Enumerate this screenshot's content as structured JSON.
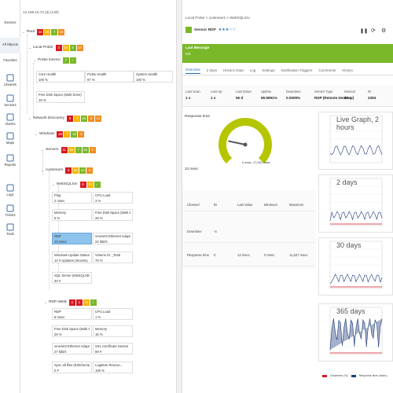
{
  "nav": [
    {
      "label": "Devices",
      "icon": "devices-icon"
    },
    {
      "label": "All Objects",
      "icon": "all-objects-icon"
    },
    {
      "label": "Favorites",
      "icon": "favorites-icon"
    },
    {
      "label": "Libraries",
      "icon": "libraries-icon"
    },
    {
      "label": "Sensors",
      "icon": "sensors-icon"
    },
    {
      "label": "Alarms",
      "icon": "alarms-icon"
    },
    {
      "label": "Maps",
      "icon": "maps-icon"
    },
    {
      "label": "Reports",
      "icon": "reports-icon"
    },
    {
      "label": "Logs",
      "icon": "logs-icon"
    },
    {
      "label": "Tickets",
      "icon": "tickets-icon"
    },
    {
      "label": "Tools",
      "icon": "tools-icon"
    }
  ],
  "tree": {
    "header": "12.168.10.72 (d) (130)",
    "nodes": [
      {
        "label": "Root",
        "badges": [
          [
            "14",
            "r"
          ],
          [
            "16",
            "y"
          ],
          [
            "7",
            "g"
          ],
          [
            "10",
            "o"
          ]
        ]
      },
      {
        "label": "Local Probe",
        "badges": [
          [
            "3",
            "r"
          ],
          [
            "16",
            "y"
          ],
          [
            "6",
            "g"
          ],
          [
            "10",
            "o"
          ]
        ]
      },
      {
        "label": "Probe Device",
        "badges": [
          [
            "7",
            "g"
          ],
          [
            "✓",
            "g"
          ]
        ]
      },
      {
        "label": "Network Discovery",
        "badges": [
          [
            "8",
            "r"
          ],
          [
            "3",
            "y"
          ],
          [
            "16",
            "g"
          ],
          [
            "6",
            "o"
          ],
          [
            "10",
            "o"
          ]
        ]
      },
      {
        "label": "Windows",
        "badges": [
          [
            "18",
            "r"
          ],
          [
            "7",
            "y"
          ],
          [
            "16",
            "g"
          ],
          [
            "6",
            "o"
          ]
        ]
      },
      {
        "label": "Servers",
        "badges": [
          [
            "11",
            "r"
          ],
          [
            "18",
            "y"
          ],
          [
            "7",
            "g"
          ],
          [
            "16",
            "g"
          ],
          [
            "6",
            "o"
          ]
        ]
      },
      {
        "label": "customers",
        "badges": [
          [
            "3",
            "r"
          ],
          [
            "10",
            "y"
          ],
          [
            "12",
            "g"
          ],
          [
            "6",
            "o"
          ]
        ]
      },
      {
        "label": "WebSQLSrv",
        "badges": [
          [
            "6",
            "r"
          ],
          [
            "10",
            "y"
          ],
          [
            "✓",
            "g"
          ]
        ]
      },
      {
        "label": "RDP-WEB",
        "badges": [
          [
            "4",
            "r"
          ],
          [
            "3",
            "r"
          ],
          [
            "10",
            "y"
          ],
          [
            "✓",
            "g"
          ]
        ]
      }
    ],
    "tiles": [
      {
        "name": "Core Health",
        "value": "100 %"
      },
      {
        "name": "Probe Health",
        "value": "97 %"
      },
      {
        "name": "System Health",
        "value": "100 %"
      },
      {
        "name": "Free Disk Space (Multi Drive)",
        "value": "19 %"
      },
      {
        "name": "Ping",
        "value": "2 msec"
      },
      {
        "name": "CPU Load",
        "value": "3 %"
      },
      {
        "name": "Memory",
        "value": "6 %"
      },
      {
        "name": "Free Disk Space (Multi Drive)",
        "value": "28 %"
      },
      {
        "name": "RDP",
        "value": "13 msec"
      },
      {
        "name": "vmxnet3 Ethernet Adapter",
        "value": "22 kbit/s"
      },
      {
        "name": "Windows Update Status",
        "value": "14 # Updates (Severity Critical, Mi..."
      },
      {
        "name": "Volume IO _Total",
        "value": "79 %"
      },
      {
        "name": "SQL Server (MSSQLSERVER) Se...",
        "value": "30 #"
      },
      {
        "name": "RDP",
        "value": "8 msec"
      },
      {
        "name": "CPU Load",
        "value": "1 %"
      },
      {
        "name": "Free Disk Space (Multi Drive)",
        "value": "28 %"
      },
      {
        "name": "Memory",
        "value": "16 %"
      },
      {
        "name": "vmxnet3 Ethernet Adapter",
        "value": "27 kbit/s"
      },
      {
        "name": "SSL Certificate Sensor",
        "value": "89 #"
      },
      {
        "name": "Sync all files (EXE/Script Sensor)",
        "value": "0 #"
      },
      {
        "name": "LogMeIn Rescue...",
        "value": "100 %"
      }
    ]
  },
  "detail": {
    "breadcrumb": "Local Probe > customers > WebSQLSrv",
    "sensor": "Sensor RDP",
    "stars": "★★★☆☆",
    "lastmsg_label": "Last Message",
    "lastmsg": "OK",
    "tabs": [
      "Overview",
      "2 days",
      "Historic Data",
      "Log",
      "Settings",
      "Notification Triggers",
      "Comments",
      "History"
    ],
    "stats": [
      {
        "h": "Last Scan",
        "v": "1 s"
      },
      {
        "h": "Last Up",
        "v": "1 s"
      },
      {
        "h": "Last Down",
        "v": "56 d"
      },
      {
        "h": "Uptime",
        "v": "99.9991%"
      },
      {
        "h": "Downtime",
        "v": "0.0009%"
      },
      {
        "h": "Sensor Type",
        "v": "RDP (Remote Desktop)"
      },
      {
        "h": "Interval",
        "v": "60 s"
      },
      {
        "h": "ID",
        "v": "2393"
      }
    ],
    "gauge": {
      "title": "Response time",
      "min": "0 msec",
      "max": "17,052 msec",
      "value": "13 msec",
      "fraction": 0.02
    },
    "channel_headers": [
      "Channel",
      "ID",
      "Last Value",
      "Minimum",
      "Maximum"
    ],
    "channels": [
      {
        "c": "Downtime",
        "id": "-4",
        "lv": "",
        "mn": "",
        "mx": ""
      },
      {
        "c": "Response time",
        "id": "0",
        "lv": "13 msec",
        "mn": "0 msec",
        "mx": "11,527 msec"
      }
    ],
    "charts": [
      {
        "title": "Live Graph, 2 hours"
      },
      {
        "title": "2 days"
      },
      {
        "title": "30 days"
      },
      {
        "title": "365 days"
      }
    ],
    "legend": [
      "Downtime (%)",
      "Response time (msec)"
    ],
    "colors": {
      "ok": "#7ab829",
      "down": "#d71920",
      "warn": "#f7b500",
      "unusual": "#f38d1f"
    }
  }
}
